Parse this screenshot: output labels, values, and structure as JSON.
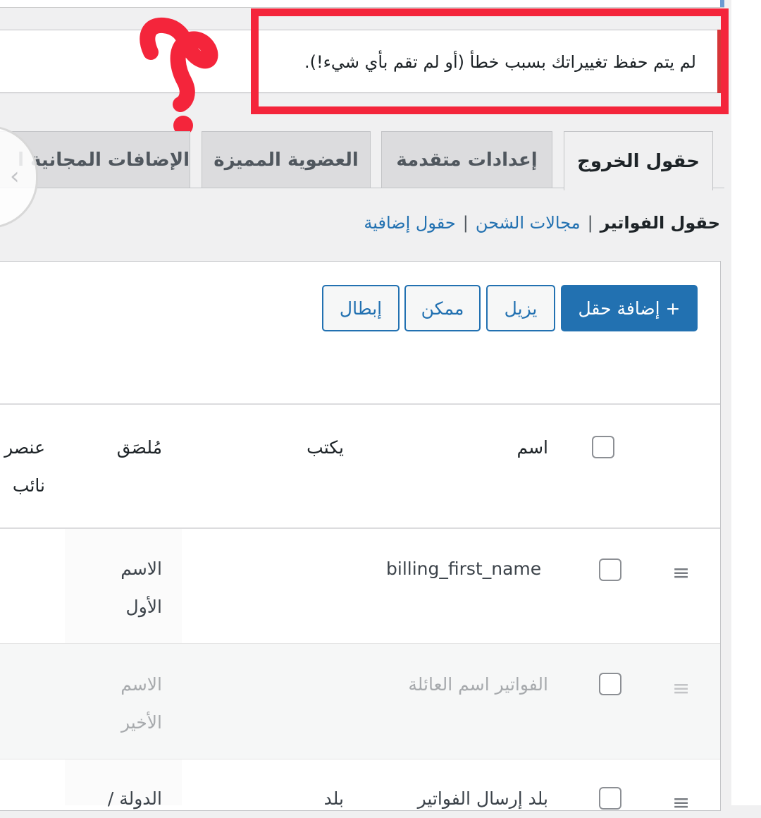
{
  "notice": {
    "message": "لم يتم حفظ تغييراتك بسبب خطأ (أو لم تقم بأي شيء!)."
  },
  "colors": {
    "accent_blue": "#2271b1",
    "error_red": "#d63638",
    "annotation_red": "#f4253b"
  },
  "tabs": [
    {
      "label": "حقول الخروج",
      "active": true
    },
    {
      "label": "إعدادات متقدمة",
      "active": false
    },
    {
      "label": "العضوية المميزة",
      "active": false
    },
    {
      "label": "الإضافات المجانية ا",
      "active": false
    }
  ],
  "subnav": {
    "current": "حقول الفواتير",
    "separator": "|",
    "links": [
      "مجالات الشحن",
      "حقول إضافية"
    ]
  },
  "toolbar": {
    "add_field": "+ إضافة حقل",
    "remove": "يزيل",
    "enable": "ممكن",
    "disable": "إبطال"
  },
  "table": {
    "headers": {
      "name": "اسم",
      "type": "يكتب",
      "label": "مُلصَق",
      "placeholder_line1": "عنصر",
      "placeholder_line2": "نائب"
    },
    "rows": [
      {
        "name": "billing_first_name",
        "type": "",
        "label_line1": "الاسم",
        "label_line2": "الأول"
      },
      {
        "name": "الفواتير اسم العائلة",
        "type": "",
        "label_line1": "الاسم",
        "label_line2": "الأخير"
      },
      {
        "name": "بلد إرسال الفواتير",
        "type": "بلد",
        "label_line1": "الدولة /"
      }
    ]
  },
  "icons": {
    "drag_handle": "≡",
    "scroll_left": "‹"
  }
}
